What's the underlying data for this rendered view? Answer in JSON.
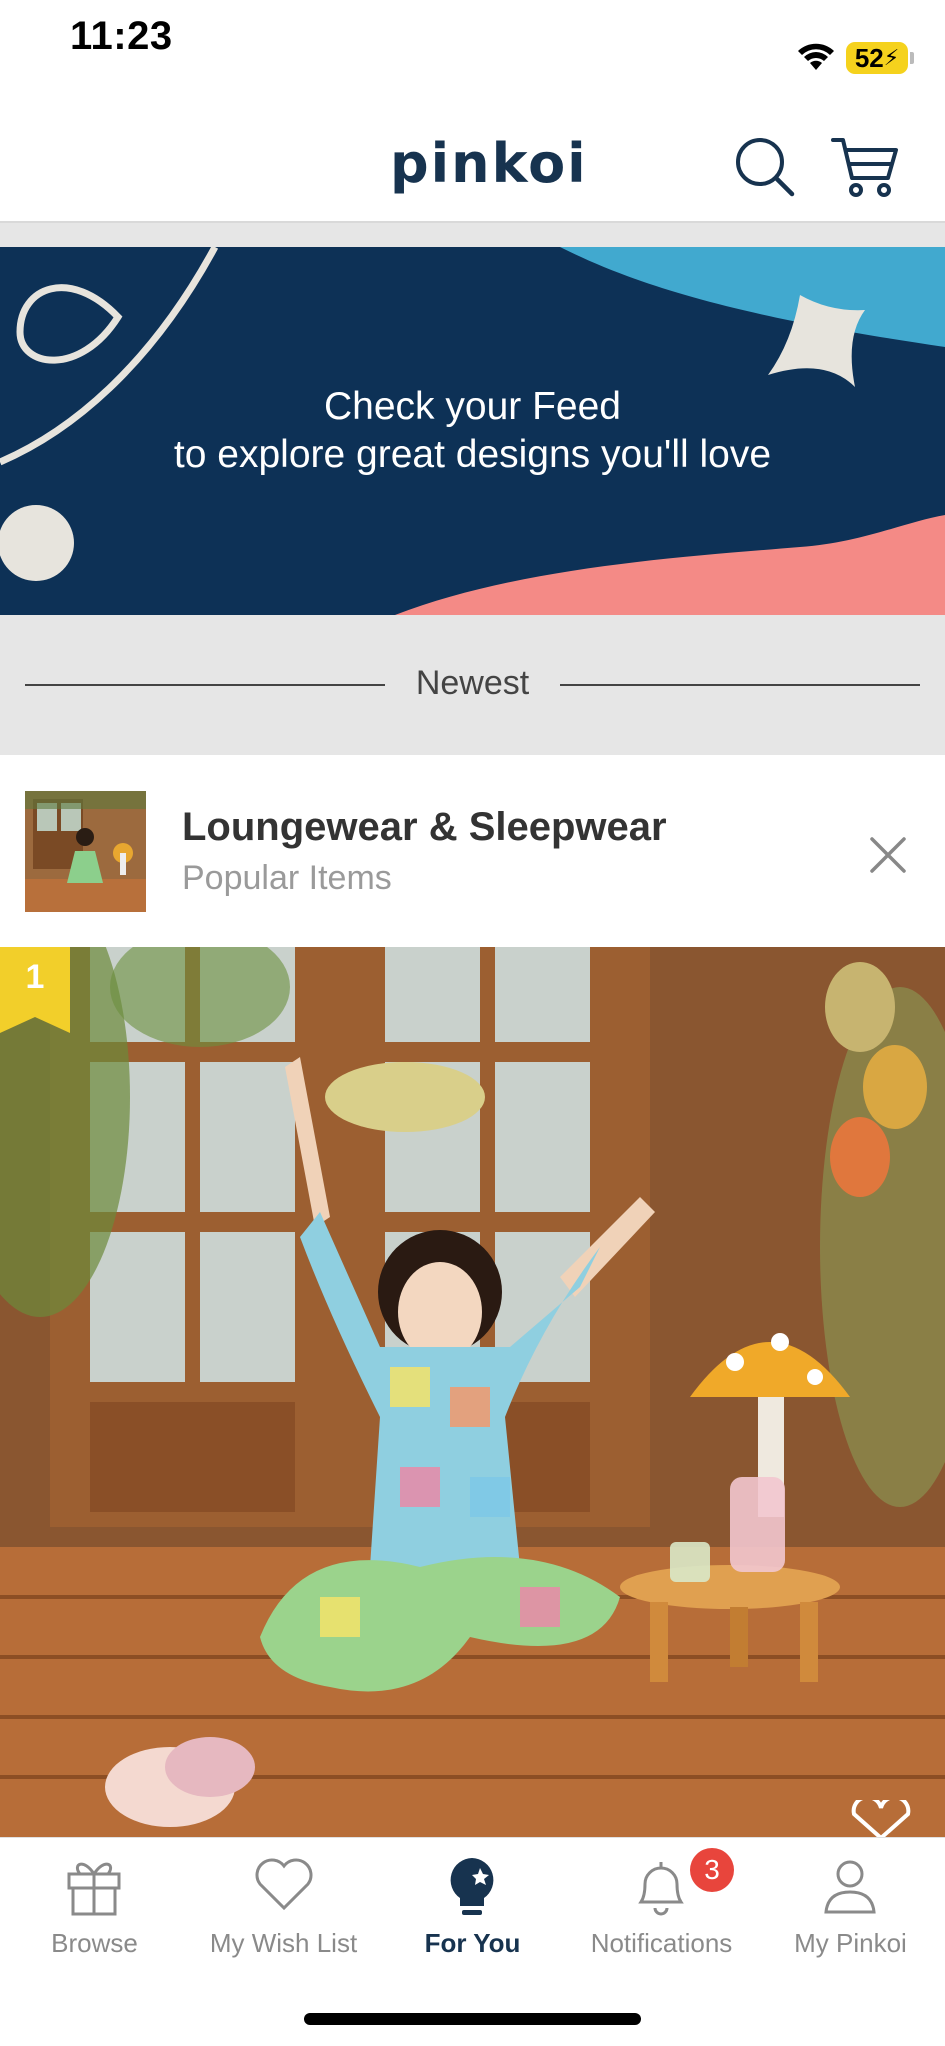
{
  "status_bar": {
    "time": "11:23",
    "battery": "52"
  },
  "header": {
    "logo": "pinkoi"
  },
  "banner": {
    "line1": "Check your Feed",
    "line2": "to explore great designs you'll love"
  },
  "section": {
    "label": "Newest"
  },
  "card": {
    "title": "Loungewear & Sleepwear",
    "subtitle": "Popular Items",
    "rank": "1"
  },
  "tabs": [
    {
      "label": "Browse",
      "icon": "gift-icon",
      "active": false
    },
    {
      "label": "My Wish List",
      "icon": "heart-icon",
      "active": false
    },
    {
      "label": "For You",
      "icon": "lightbulb-icon",
      "active": true
    },
    {
      "label": "Notifications",
      "icon": "bell-icon",
      "active": false,
      "badge": "3"
    },
    {
      "label": "My Pinkoi",
      "icon": "user-icon",
      "active": false
    }
  ],
  "colors": {
    "brand_navy": "#17334f",
    "banner_bg": "#0d3156",
    "badge_red": "#e8453c",
    "rank_yellow": "#f2cf2a"
  }
}
